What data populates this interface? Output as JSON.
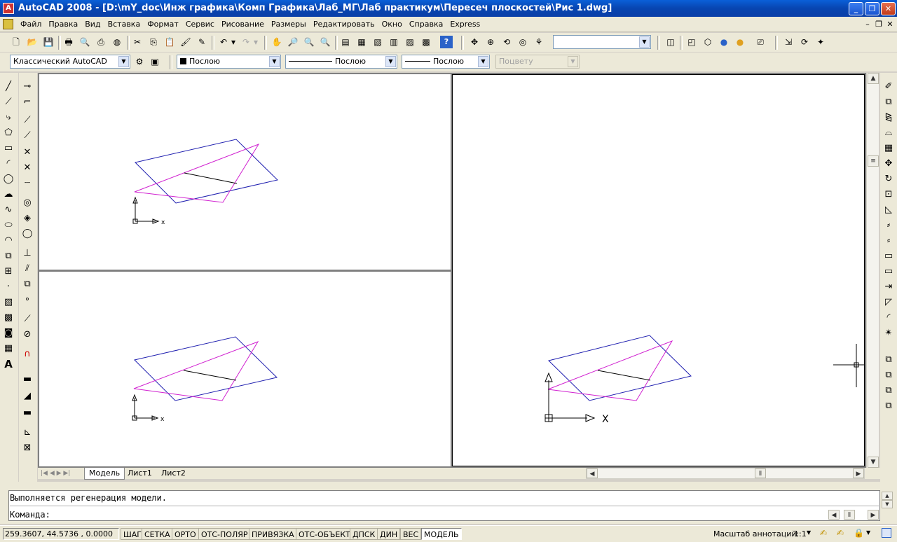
{
  "window": {
    "title": "AutoCAD 2008 - [D:\\mY_doc\\Инж графика\\Комп Графика\\Лаб_МГ\\Лаб практикум\\Пересеч плоскостей\\Рис 1.dwg]"
  },
  "menu": [
    "Файл",
    "Правка",
    "Вид",
    "Вставка",
    "Формат",
    "Сервис",
    "Рисование",
    "Размеры",
    "Редактировать",
    "Окно",
    "Справка",
    "Express"
  ],
  "properties_toolbar": {
    "workspace": "Классический AutoCAD",
    "color": "Послою",
    "linetype": "Послою",
    "lineweight": "Послою",
    "plotstyle": "Поцвету"
  },
  "ucs_labels": {
    "x_small": "x",
    "x_large": "X"
  },
  "tabs": [
    "Модель",
    "Лист1",
    "Лист2"
  ],
  "command": {
    "history": "Выполняется регенерация модели.",
    "prompt": "Команда:"
  },
  "status": {
    "coords": "259.3607, 44.5736 , 0.0000",
    "toggles": [
      "ШАГ",
      "СЕТКА",
      "ОРТО",
      "ОТС-ПОЛЯР",
      "ПРИВЯЗКА",
      "ОТС-ОБЪЕКТ",
      "ДПСК",
      "ДИН",
      "ВЕС",
      "МОДЕЛЬ"
    ],
    "annotation_scale_label": "Масштаб аннотаций:",
    "annotation_scale_value": "1:1"
  },
  "colors": {
    "plane_a": "#2020b0",
    "plane_b": "#d020d0",
    "intersection": "#000000"
  }
}
